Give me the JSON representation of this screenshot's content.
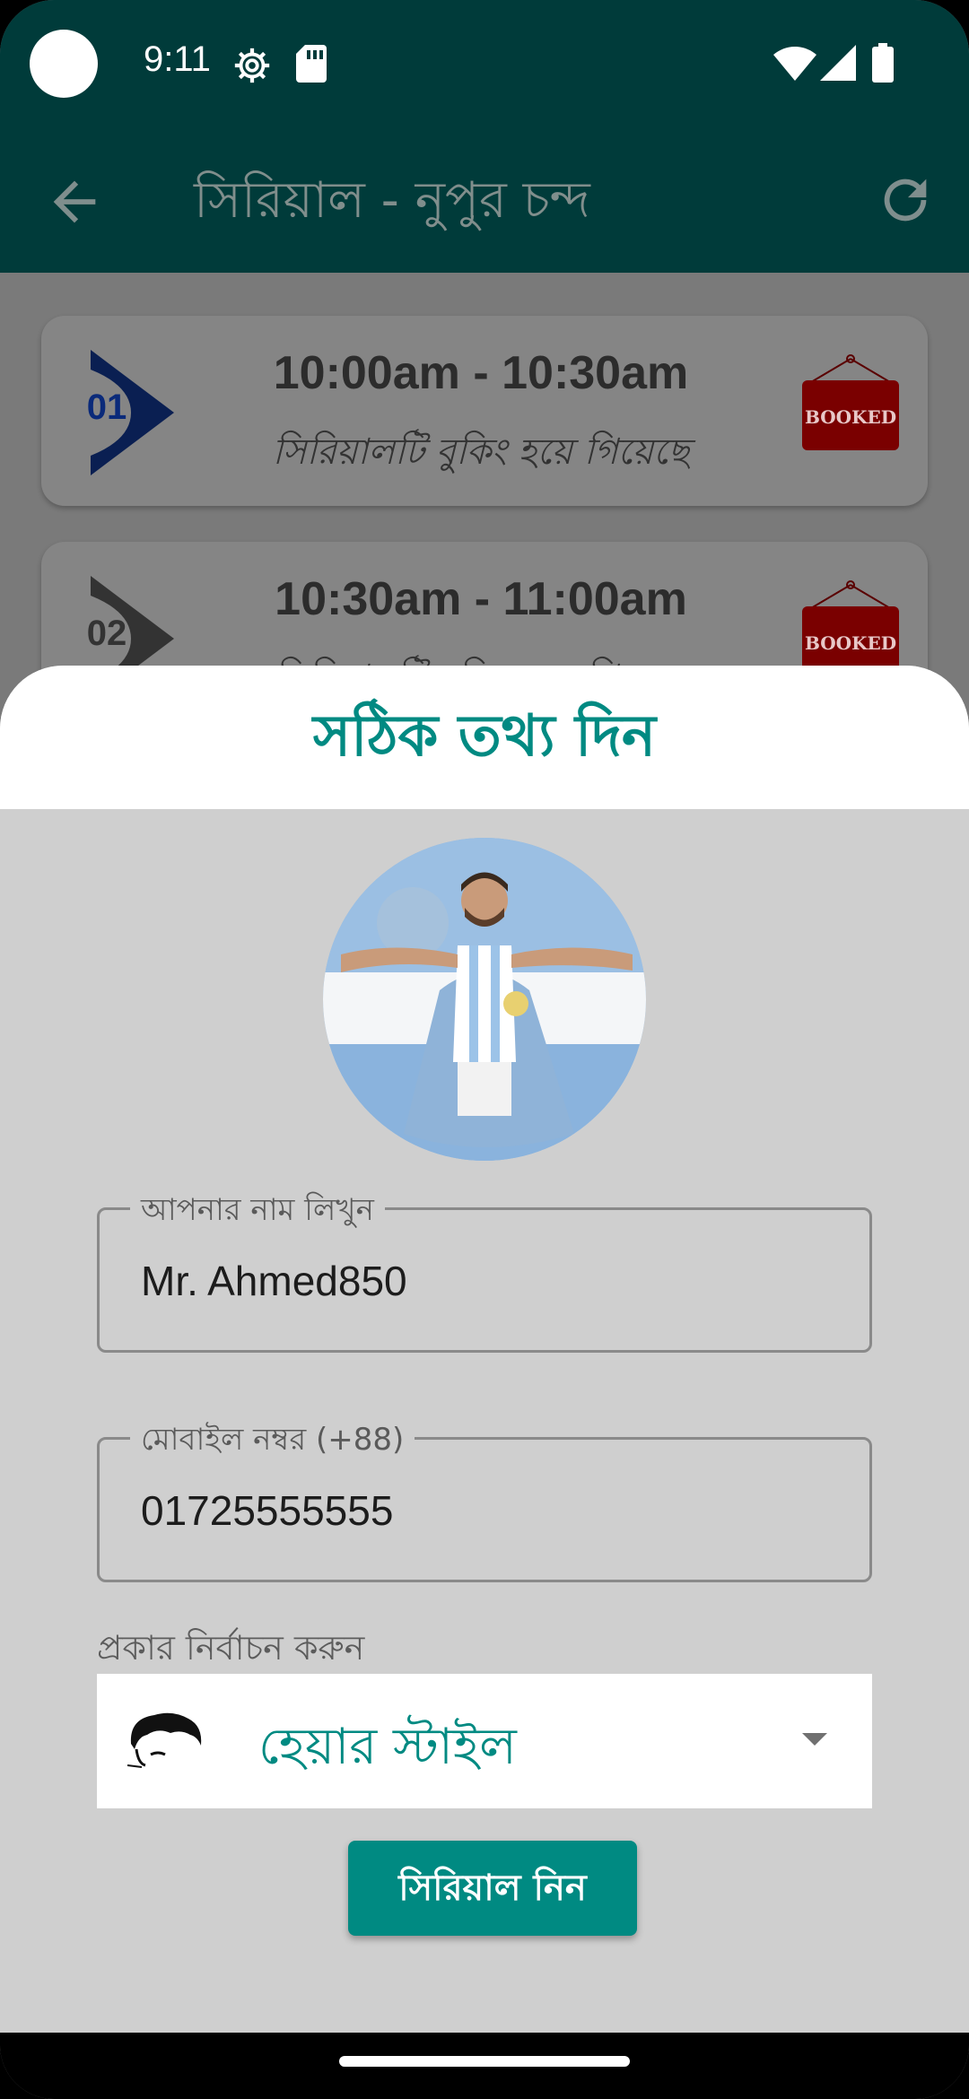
{
  "status_bar": {
    "time": "9:11"
  },
  "appbar": {
    "title": "সিরিয়াল - নুপুর চন্দ",
    "back_icon": "arrow-back-icon",
    "refresh_icon": "refresh-icon"
  },
  "slots": [
    {
      "number": "01",
      "time": "10:00am - 10:30am",
      "status": "সিরিয়ালটি বুকিং হয়ে গিয়েছে",
      "badge": "BOOKED"
    },
    {
      "number": "02",
      "time": "10:30am - 11:00am",
      "status": "সিরিয়ালটি বুকিং হয়ে গিয়েছে",
      "badge": "BOOKED"
    }
  ],
  "sheet": {
    "title": "সঠিক তথ্য দিন",
    "name_field": {
      "label": "আপনার নাম লিখুন",
      "value": "Mr. Ahmed850"
    },
    "mobile_field": {
      "label": "মোবাইল নম্বর (+88)",
      "value": "01725555555"
    },
    "type_select": {
      "label": "প্রকার নির্বাচন করুন",
      "value": "হেয়ার স্টাইল",
      "icon": "hair-style-icon"
    },
    "submit_label": "সিরিয়াল নিন"
  },
  "colors": {
    "appbar": "#003b3a",
    "accent": "#008a82",
    "booked": "#7a0000"
  }
}
